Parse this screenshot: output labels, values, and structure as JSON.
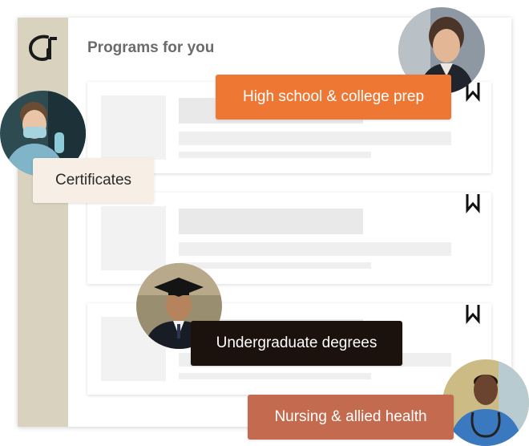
{
  "header": {
    "title": "Programs for you"
  },
  "brand": {
    "logo_icon": "g-monogram-logo",
    "accent_color": "#d8d2bf"
  },
  "cards": [
    {
      "bookmark_icon": "bookmark-icon"
    },
    {
      "bookmark_icon": "bookmark-icon"
    },
    {
      "bookmark_icon": "bookmark-icon"
    }
  ],
  "categories": {
    "high_school": {
      "label": "High school & college prep",
      "color": "#ee7734"
    },
    "certificates": {
      "label": "Certificates",
      "color": "#f7efe5"
    },
    "undergraduate": {
      "label": "Undergraduate degrees",
      "color": "#1c120d"
    },
    "nursing": {
      "label": "Nursing & allied health",
      "color": "#c46a4f"
    }
  }
}
